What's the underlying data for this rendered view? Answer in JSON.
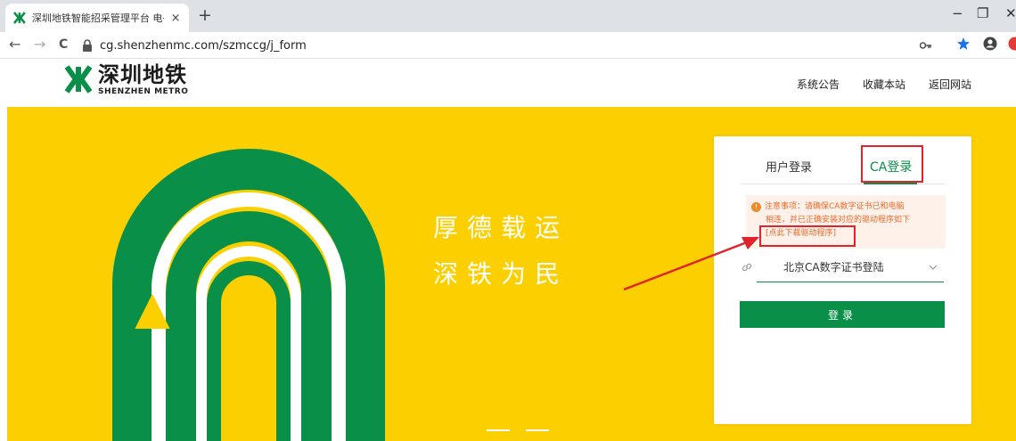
{
  "browser": {
    "tab_title": "深圳地铁智能招采管理平台 电子",
    "tab_close": "×",
    "new_tab": "+",
    "url": "cg.shenzhenmc.com/szmccg/j_form",
    "nav": {
      "back": "←",
      "forward": "→",
      "reload": "C"
    },
    "window": {
      "minimize": "−",
      "restore": "❐",
      "close": "✕"
    }
  },
  "header": {
    "logo_cn": "深圳地铁",
    "logo_en": "SHENZHEN METRO",
    "links": [
      "系统公告",
      "收藏本站",
      "返回网站"
    ]
  },
  "banner": {
    "slogan_line1": "厚德载运",
    "slogan_line2": "深铁为民"
  },
  "login": {
    "tab_user": "用户登录",
    "tab_ca": "CA登录",
    "notice_line1": "注意事项：请确保CA数字证书已和电脑",
    "notice_line2": "相连，并已正确安装对应的驱动程序如下",
    "download_link": "[点此下载驱动程序]",
    "ca_select_value": "北京CA数字证书登陆",
    "submit": "登录"
  },
  "colors": {
    "brand_green": "#0a8f48",
    "banner_yellow": "#fccf00",
    "notice_orange": "#ef6a2a",
    "annotation_red": "#e0242d"
  },
  "icons": {
    "favicon": "shenzhen-metro-logo",
    "lock": "lock-icon",
    "key": "key-icon",
    "star": "star-icon",
    "account": "account-icon",
    "link": "link-icon",
    "chevron": "chevron-down-icon"
  }
}
